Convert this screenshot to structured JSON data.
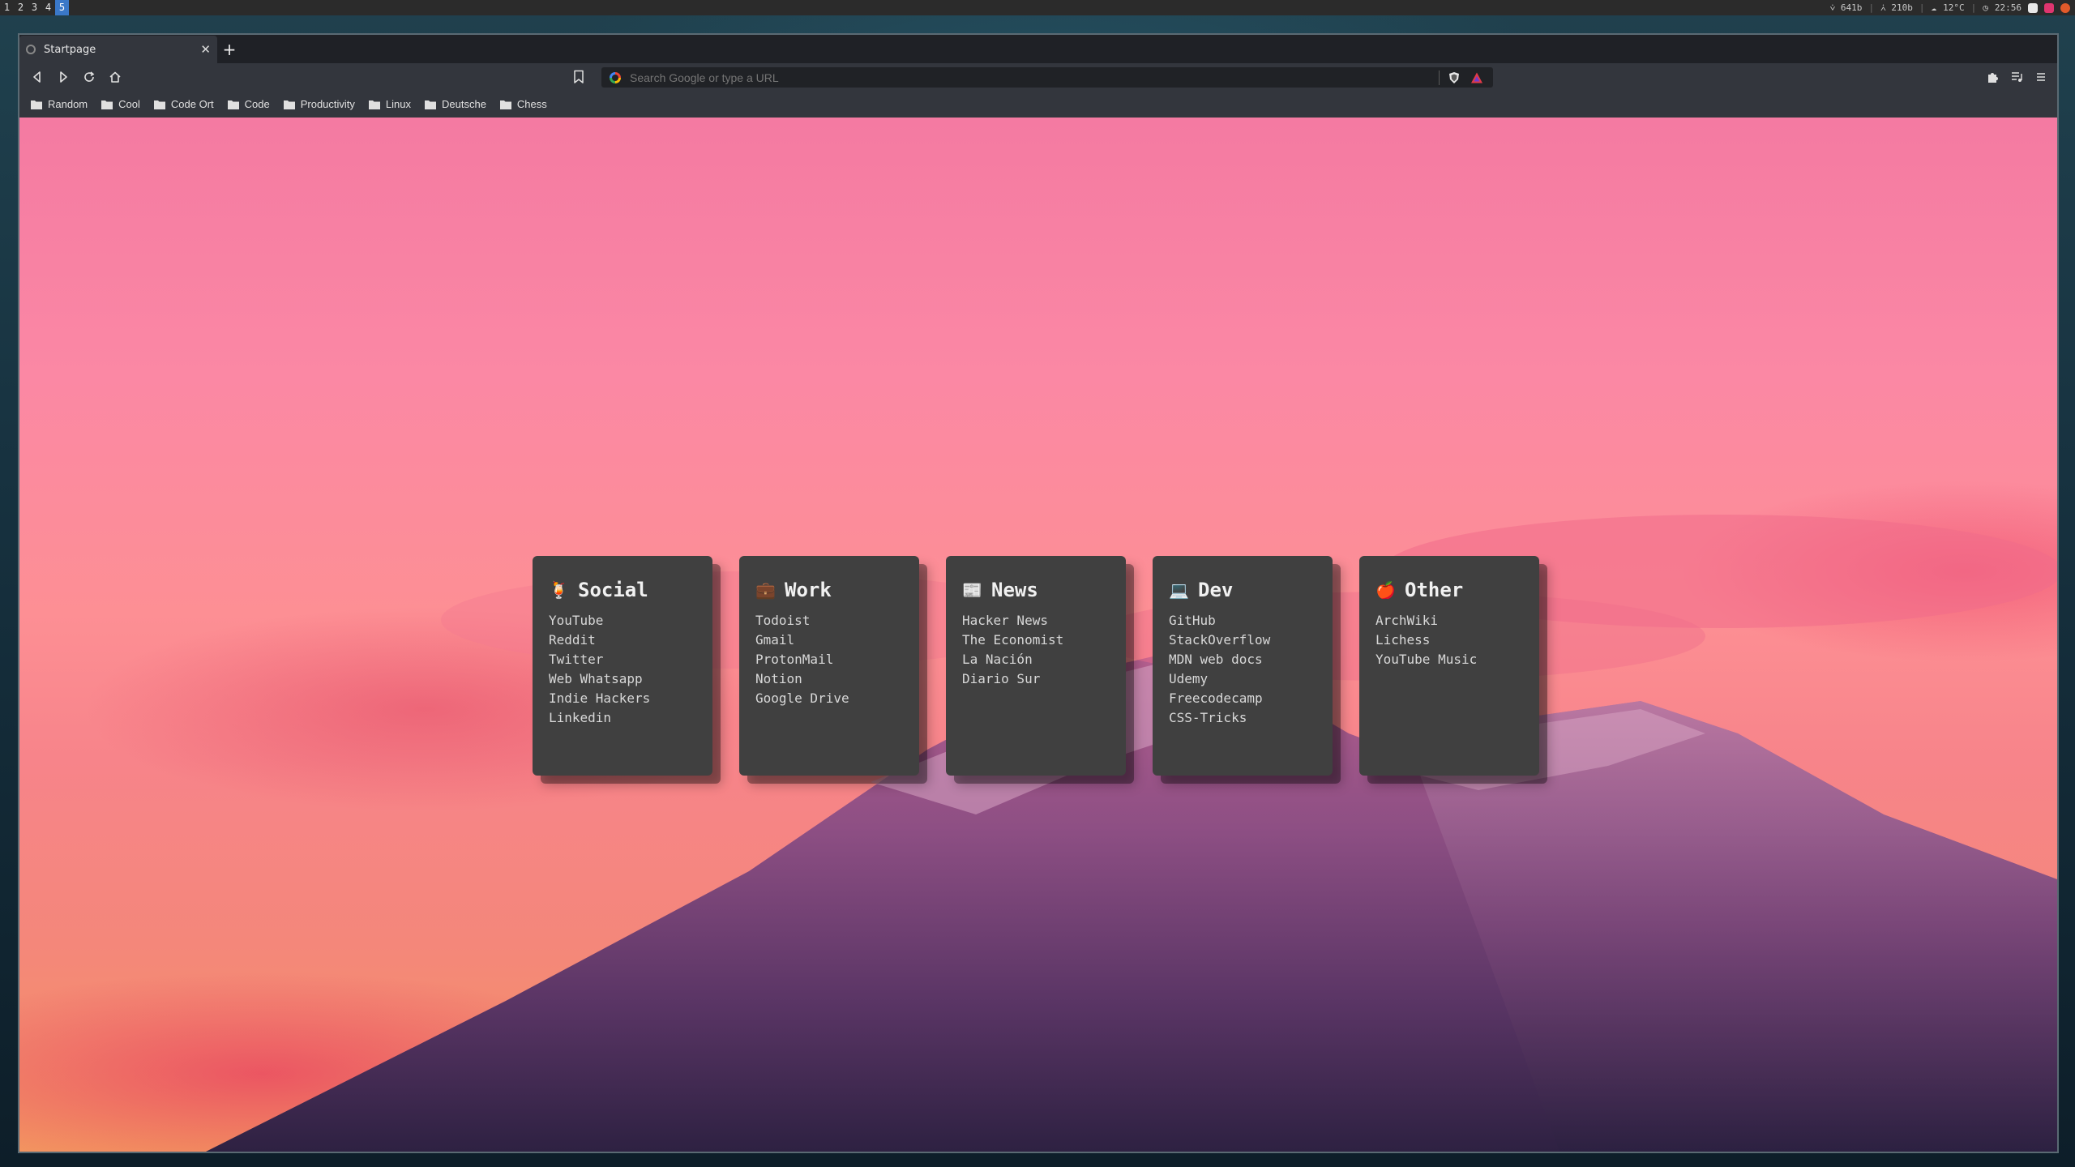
{
  "topbar": {
    "workspaces": [
      "1",
      "2",
      "3",
      "4",
      "5"
    ],
    "active_workspace": "5",
    "net_down": "⩒ 641b",
    "net_up": "⩑ 210b",
    "weather": "12°C",
    "clock": "22:56"
  },
  "browser": {
    "tab": {
      "title": "Startpage",
      "close": "✕"
    },
    "new_tab": "+",
    "omnibox": {
      "placeholder": "Search Google or type a URL"
    },
    "bookmarks": [
      "Random",
      "Cool",
      "Code Ort",
      "Code",
      "Productivity",
      "Linux",
      "Deutsche",
      "Chess"
    ]
  },
  "startpage": {
    "cards": [
      {
        "emoji": "🍹",
        "title": "Social",
        "links": [
          "YouTube",
          "Reddit",
          "Twitter",
          "Web Whatsapp",
          "Indie Hackers",
          "Linkedin"
        ]
      },
      {
        "emoji": "💼",
        "title": "Work",
        "links": [
          "Todoist",
          "Gmail",
          "ProtonMail",
          "Notion",
          "Google Drive"
        ]
      },
      {
        "emoji": "📰",
        "title": "News",
        "links": [
          "Hacker News",
          "The Economist",
          "La Nación",
          "Diario Sur"
        ]
      },
      {
        "emoji": "💻",
        "title": "Dev",
        "links": [
          "GitHub",
          "StackOverflow",
          "MDN web docs",
          "Udemy",
          "Freecodecamp",
          "CSS-Tricks"
        ]
      },
      {
        "emoji": "🍎",
        "title": "Other",
        "links": [
          "ArchWiki",
          "Lichess",
          "YouTube Music"
        ]
      }
    ]
  },
  "colors": {
    "active_workspace": "#3a78c8",
    "card_bg": "#404040",
    "card_text": "#d8d8d8"
  }
}
